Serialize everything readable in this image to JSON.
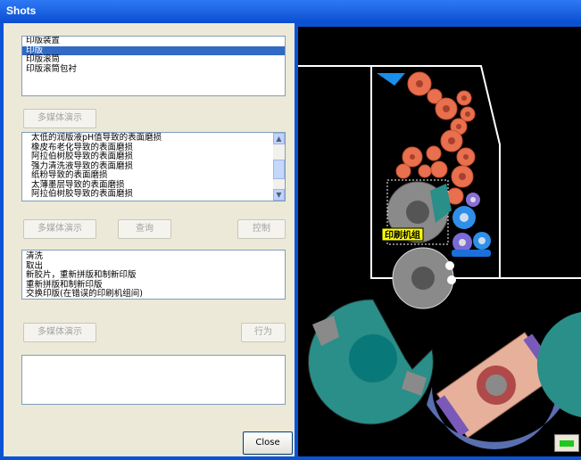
{
  "window": {
    "title": "Shots"
  },
  "part_list": {
    "items": [
      "印版装置",
      "印版",
      "印版滚筒",
      "印版滚筒包衬"
    ],
    "selected_index": 1
  },
  "buttons": {
    "multimedia_1": "多媒体演示",
    "multimedia_2": "多媒体演示",
    "query": "查询",
    "control": "控制",
    "multimedia_3": "多媒体演示",
    "action": "行为",
    "close": "Close"
  },
  "defect_list": {
    "items": [
      "太低的润版液pH值导致的表面磨损",
      "橡皮布老化导致的表面磨损",
      "阿拉伯树胶导致的表面磨损",
      "强力清洗液导致的表面磨损",
      "纸粉导致的表面磨损",
      "太薄墨层导致的表面磨损",
      "阿拉伯树胶导致的表面磨损"
    ]
  },
  "action_list": {
    "items": [
      "清洗",
      "取出",
      "新胶片，重新拼版和制新印版",
      "重新拼版和制新印版",
      "交换印版(在错误的印刷机组间)"
    ]
  },
  "diagram": {
    "unit_label": "印刷机组"
  },
  "colors": {
    "accent": "#316ac5",
    "cyan_roller": "#2a8e89",
    "orange_roller": "#e8704e",
    "blue_roller": "#3a9cf0",
    "status_led": "#1ec81e"
  }
}
